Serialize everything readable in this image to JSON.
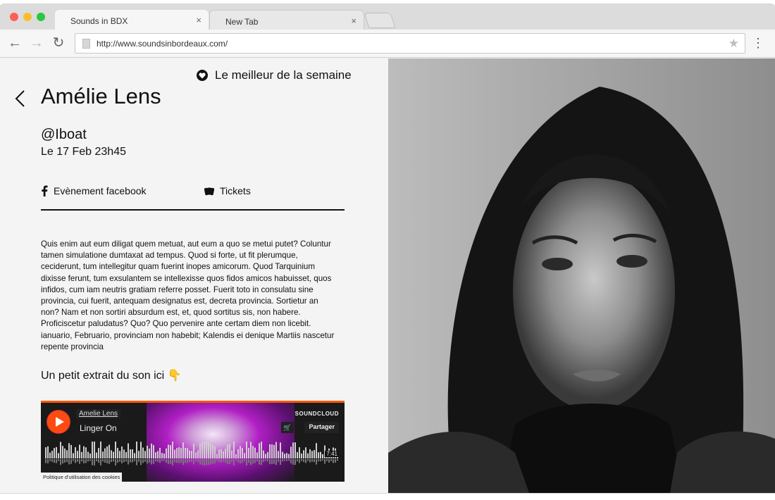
{
  "browser": {
    "tabs": [
      {
        "label": "Sounds in BDX",
        "close": "×"
      },
      {
        "label": "New Tab",
        "close": "×"
      }
    ],
    "url": "http://www.soundsinbordeaux.com/",
    "nav": {
      "back": "←",
      "forward": "→",
      "reload": "↻"
    },
    "star": "★",
    "menu": "⋮"
  },
  "page": {
    "best_label": "Le meilleur de la semaine",
    "title": "Amélie Lens",
    "handle": "@Iboat",
    "date": "Le 17 Feb 23h45",
    "facebook_label": "Evènement facebook",
    "tickets_label": "Tickets",
    "body": "Quis enim aut eum diligat quem metuat, aut eum a quo se metui putet? Coluntur tamen simulatione dumtaxat ad tempus. Quod si forte, ut fit plerumque, ceciderunt, tum intellegitur quam fuerint inopes amicorum. Quod Tarquinium dixisse ferunt, tum exsulantem se intellexisse quos fidos amicos habuisset, quos infidos, cum iam neutris gratiam referre posset. Fuerit toto in consulatu sine provincia, cui fuerit, antequam designatus est, decreta provincia. Sortietur an non? Nam et non sortiri absurdum est, et, quod sortitus sis, non habere. Proficiscetur paludatus? Quo? Quo pervenire ante certam diem non licebit. ianuario, Februario, provinciam non habebit; Kalendis ei denique Martiis nascetur repente provincia",
    "extract_label": "Un petit extrait du son ici 👇"
  },
  "soundcloud": {
    "artist": "Amelie Lens",
    "track": "Linger On",
    "brand": "SOUNDCLOUD",
    "cart": "🛒",
    "share": "Partager",
    "duration": "7:41",
    "cookies": "Politique d'utilisation des cookies",
    "accent": "#ff5500"
  },
  "icons": {
    "back": "chevron-left-icon",
    "heart": "heart-badge-icon",
    "facebook": "facebook-icon",
    "tickets": "tickets-icon",
    "play": "play-icon"
  }
}
